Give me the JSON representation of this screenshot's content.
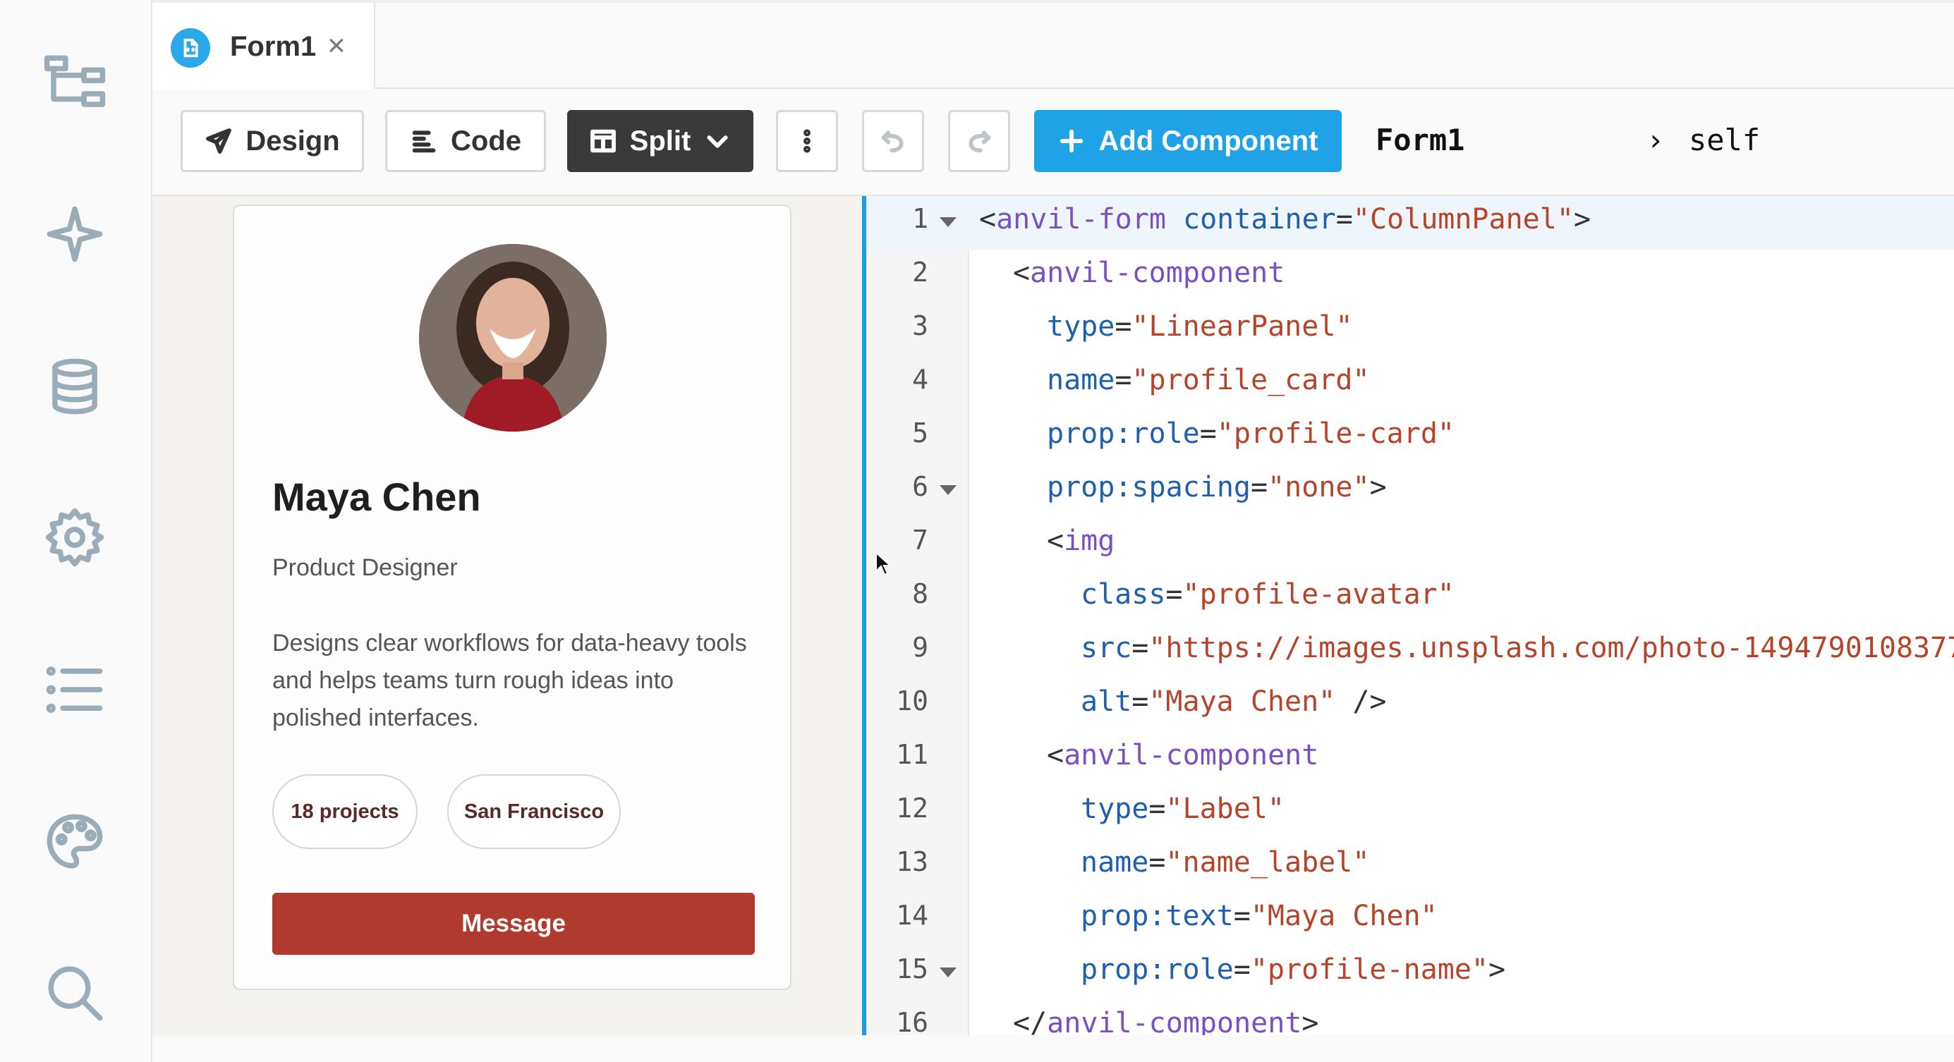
{
  "tab": {
    "title": "Form1",
    "close_glyph": "×"
  },
  "rail": {
    "icons": [
      "app-browser-icon",
      "ai-sparkle-icon",
      "data-tables-icon",
      "settings-gear-icon",
      "outline-list-icon",
      "theme-palette-icon",
      "search-icon"
    ]
  },
  "toolbar": {
    "design_label": "Design",
    "code_label": "Code",
    "split_label": "Split",
    "add_component_label": "Add Component",
    "breadcrumb_root": "Form1",
    "breadcrumb_sep": "›",
    "breadcrumb_leaf": "self"
  },
  "card": {
    "name": "Maya Chen",
    "role": "Product Designer",
    "bio": "Designs clear workflows for data-heavy tools and helps teams turn rough ideas into polished interfaces.",
    "pill_projects": "18 projects",
    "pill_location": "San Francisco",
    "message_label": "Message",
    "avatar_alt": "Maya Chen"
  },
  "editor": {
    "lines": [
      {
        "n": "1",
        "fold": true,
        "active": true,
        "indent": 0,
        "tokens": [
          {
            "t": "p",
            "v": "<"
          },
          {
            "t": "tag",
            "v": "anvil-form"
          },
          {
            "t": "p",
            "v": " "
          },
          {
            "t": "attr",
            "v": "container"
          },
          {
            "t": "p",
            "v": "="
          },
          {
            "t": "str",
            "v": "\"ColumnPanel\""
          },
          {
            "t": "p",
            "v": ">"
          }
        ]
      },
      {
        "n": "2",
        "indent": 1,
        "tokens": [
          {
            "t": "p",
            "v": "<"
          },
          {
            "t": "tag",
            "v": "anvil-component"
          }
        ]
      },
      {
        "n": "3",
        "indent": 2,
        "tokens": [
          {
            "t": "attr",
            "v": "type"
          },
          {
            "t": "p",
            "v": "="
          },
          {
            "t": "str",
            "v": "\"LinearPanel\""
          }
        ]
      },
      {
        "n": "4",
        "indent": 2,
        "tokens": [
          {
            "t": "attr",
            "v": "name"
          },
          {
            "t": "p",
            "v": "="
          },
          {
            "t": "str",
            "v": "\"profile_card\""
          }
        ]
      },
      {
        "n": "5",
        "indent": 2,
        "tokens": [
          {
            "t": "attr",
            "v": "prop:role"
          },
          {
            "t": "p",
            "v": "="
          },
          {
            "t": "str",
            "v": "\"profile-card\""
          }
        ]
      },
      {
        "n": "6",
        "fold": true,
        "indent": 2,
        "tokens": [
          {
            "t": "attr",
            "v": "prop:spacing"
          },
          {
            "t": "p",
            "v": "="
          },
          {
            "t": "str",
            "v": "\"none\""
          },
          {
            "t": "p",
            "v": ">"
          }
        ]
      },
      {
        "n": "7",
        "indent": 2,
        "tokens": [
          {
            "t": "p",
            "v": "<"
          },
          {
            "t": "tag",
            "v": "img"
          }
        ]
      },
      {
        "n": "8",
        "indent": 3,
        "tokens": [
          {
            "t": "attr",
            "v": "class"
          },
          {
            "t": "p",
            "v": "="
          },
          {
            "t": "str",
            "v": "\"profile-avatar\""
          }
        ]
      },
      {
        "n": "9",
        "indent": 3,
        "tokens": [
          {
            "t": "attr",
            "v": "src"
          },
          {
            "t": "p",
            "v": "="
          },
          {
            "t": "str",
            "v": "\"https://images.unsplash.com/photo-1494790108377"
          }
        ]
      },
      {
        "n": "10",
        "indent": 3,
        "tokens": [
          {
            "t": "attr",
            "v": "alt"
          },
          {
            "t": "p",
            "v": "="
          },
          {
            "t": "str",
            "v": "\"Maya Chen\""
          },
          {
            "t": "p",
            "v": " />"
          }
        ]
      },
      {
        "n": "11",
        "indent": 2,
        "tokens": [
          {
            "t": "p",
            "v": "<"
          },
          {
            "t": "tag",
            "v": "anvil-component"
          }
        ]
      },
      {
        "n": "12",
        "indent": 3,
        "tokens": [
          {
            "t": "attr",
            "v": "type"
          },
          {
            "t": "p",
            "v": "="
          },
          {
            "t": "str",
            "v": "\"Label\""
          }
        ]
      },
      {
        "n": "13",
        "indent": 3,
        "tokens": [
          {
            "t": "attr",
            "v": "name"
          },
          {
            "t": "p",
            "v": "="
          },
          {
            "t": "str",
            "v": "\"name_label\""
          }
        ]
      },
      {
        "n": "14",
        "indent": 3,
        "tokens": [
          {
            "t": "attr",
            "v": "prop:text"
          },
          {
            "t": "p",
            "v": "="
          },
          {
            "t": "str",
            "v": "\"Maya Chen\""
          }
        ]
      },
      {
        "n": "15",
        "fold": true,
        "indent": 3,
        "tokens": [
          {
            "t": "attr",
            "v": "prop:role"
          },
          {
            "t": "p",
            "v": "="
          },
          {
            "t": "str",
            "v": "\"profile-name\""
          },
          {
            "t": "p",
            "v": ">"
          }
        ]
      },
      {
        "n": "16",
        "indent": 1,
        "tokens": [
          {
            "t": "p",
            "v": "</"
          },
          {
            "t": "tag",
            "v": "anvil-component"
          },
          {
            "t": "p",
            "v": ">"
          }
        ]
      }
    ]
  }
}
